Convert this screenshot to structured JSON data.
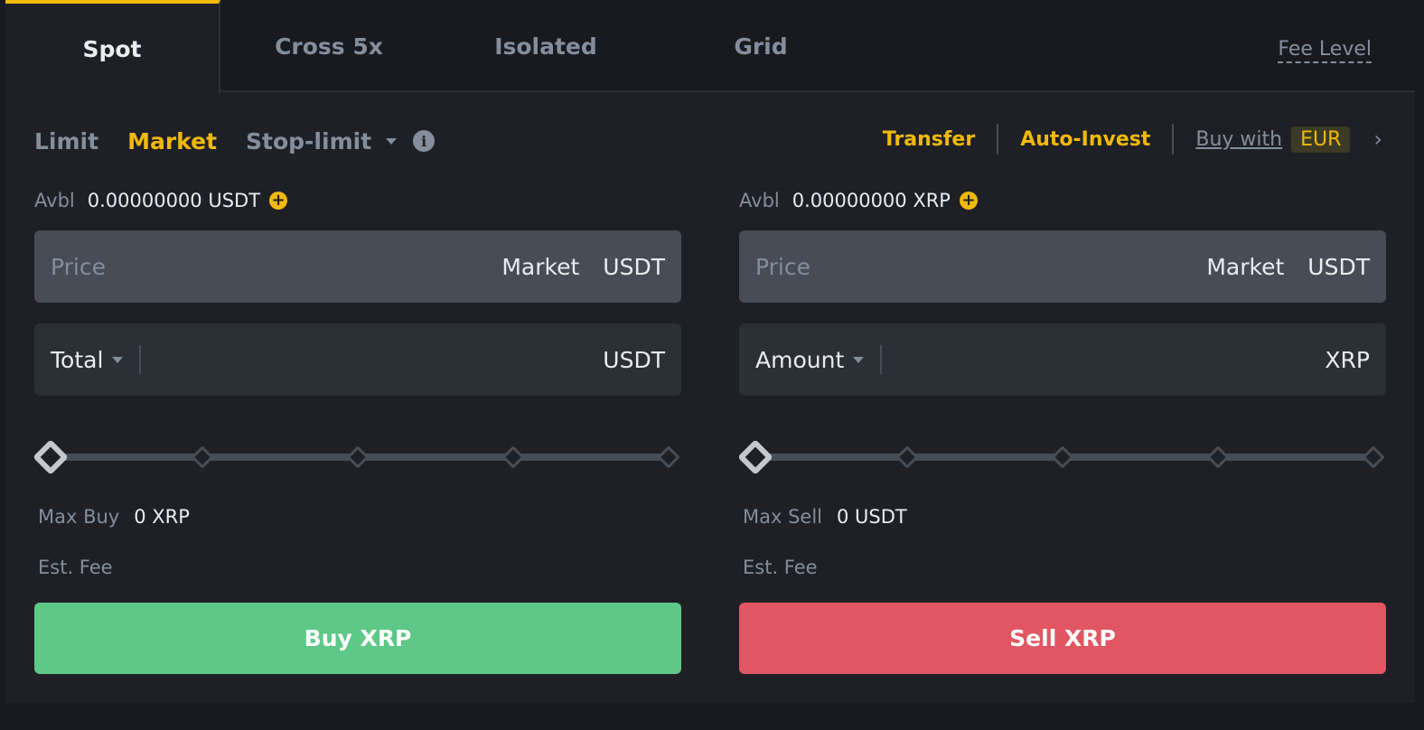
{
  "tabs": [
    {
      "label": "Spot",
      "active": true
    },
    {
      "label": "Cross 5x",
      "active": false
    },
    {
      "label": "Isolated",
      "active": false
    },
    {
      "label": "Grid",
      "active": false
    }
  ],
  "fee_level_label": "Fee Level",
  "order_types": [
    {
      "label": "Limit",
      "active": false
    },
    {
      "label": "Market",
      "active": true
    },
    {
      "label": "Stop-limit",
      "active": false
    }
  ],
  "links": {
    "transfer": "Transfer",
    "auto_invest": "Auto-Invest",
    "buy_with": "Buy with",
    "currency": "EUR"
  },
  "icons": {
    "info": "i",
    "plus": "+",
    "chevron_right": "›"
  },
  "colors": {
    "accent": "#f0b90b",
    "buy": "#5dc887",
    "sell": "#e25563",
    "background": "#1e2026"
  },
  "buy": {
    "avbl_label": "Avbl",
    "avbl_value": "0.00000000 USDT",
    "price_placeholder": "Price",
    "price_mode": "Market",
    "price_unit": "USDT",
    "qty_selector": "Total",
    "qty_value": "",
    "qty_unit": "USDT",
    "slider_percent": 0,
    "max_label": "Max Buy",
    "max_value": "0 XRP",
    "fee_label": "Est. Fee",
    "button_label": "Buy XRP"
  },
  "sell": {
    "avbl_label": "Avbl",
    "avbl_value": "0.00000000 XRP",
    "price_placeholder": "Price",
    "price_mode": "Market",
    "price_unit": "USDT",
    "qty_selector": "Amount",
    "qty_value": "",
    "qty_unit": "XRP",
    "slider_percent": 0,
    "max_label": "Max Sell",
    "max_value": "0 USDT",
    "fee_label": "Est. Fee",
    "button_label": "Sell XRP"
  }
}
